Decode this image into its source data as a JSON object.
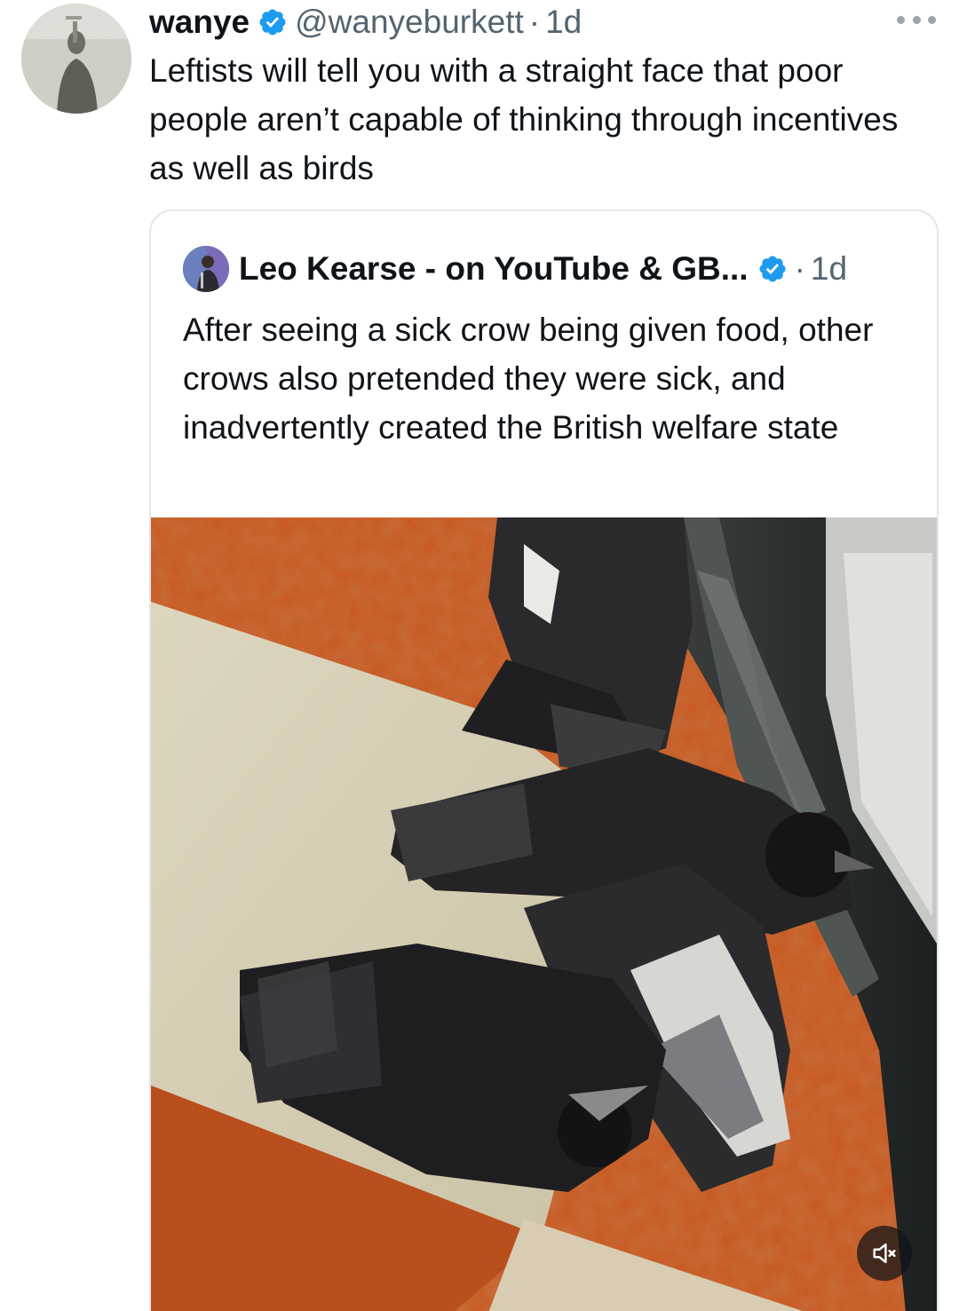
{
  "tweet": {
    "author": {
      "name": "wanye",
      "handle": "@wanyeburkett",
      "verified": true,
      "avatar_icon": "profile-photo"
    },
    "separator": "·",
    "time": "1d",
    "text": "Leftists will tell you with a straight face that poor people aren’t capable of thinking through incentives as well as birds",
    "more_icon": "more-horizontal-icon"
  },
  "quote": {
    "author": {
      "name": "Leo Kearse - on YouTube & GB...",
      "verified": true,
      "avatar_icon": "profile-photo"
    },
    "separator": "·",
    "time": "1d",
    "text": "After seeing a sick crow being given food, other crows also pretended they were sick, and inadvertently created the British welfare state",
    "media": {
      "kind": "video",
      "mute_icon": "speaker-muted-icon"
    }
  },
  "colors": {
    "text_primary": "#0f1419",
    "text_secondary": "#536471",
    "verified_blue": "#1d9bf0",
    "card_border": "#e2e6e9"
  }
}
